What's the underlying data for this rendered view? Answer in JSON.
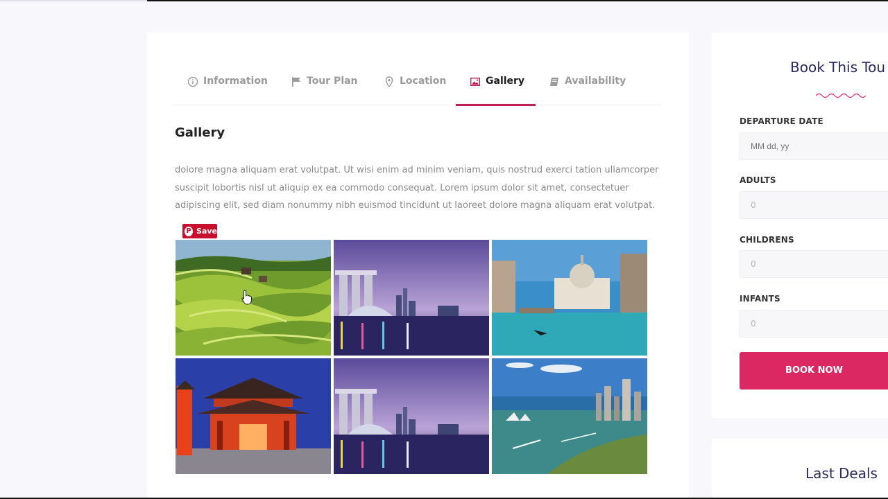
{
  "tabs": [
    {
      "label": "Information",
      "icon": "info-icon"
    },
    {
      "label": "Tour Plan",
      "icon": "flag-icon"
    },
    {
      "label": "Location",
      "icon": "map-pin-icon"
    },
    {
      "label": "Gallery",
      "icon": "image-icon",
      "active": true
    },
    {
      "label": "Availability",
      "icon": "book-icon"
    }
  ],
  "gallery": {
    "title": "Gallery",
    "description": "dolore magna aliquam erat volutpat. Ut wisi enim ad minim veniam, quis nostrud exerci tation ullamcorper suscipit lobortis nisl ut aliquip ex ea commodo consequat. Lorem ipsum dolor sit amet, consectetuer adipiscing elit, sed diam nonummy nibh euismod tincidunt ut laoreet dolore magna aliquam erat volutpat.",
    "pin_save_label": "Save",
    "photos": [
      "rice-terraces",
      "singapore-marina-bay",
      "venice-grand-canal",
      "japanese-temple-gate",
      "singapore-marina-bay",
      "sydney-harbour"
    ]
  },
  "booking": {
    "title": "Book This Tou",
    "departure_label": "DEPARTURE DATE",
    "departure_placeholder": "MM dd, yy",
    "adults_label": "ADULTS",
    "adults_value": "0",
    "children_label": "CHILDRENS",
    "children_value": "0",
    "infants_label": "INFANTS",
    "infants_value": "0",
    "button_label": "BOOK NOW"
  },
  "deals": {
    "title": "Last Deals"
  },
  "colors": {
    "accent": "#db2863",
    "tab_active_underline": "#c21d52",
    "heading": "#2b2a5e"
  }
}
